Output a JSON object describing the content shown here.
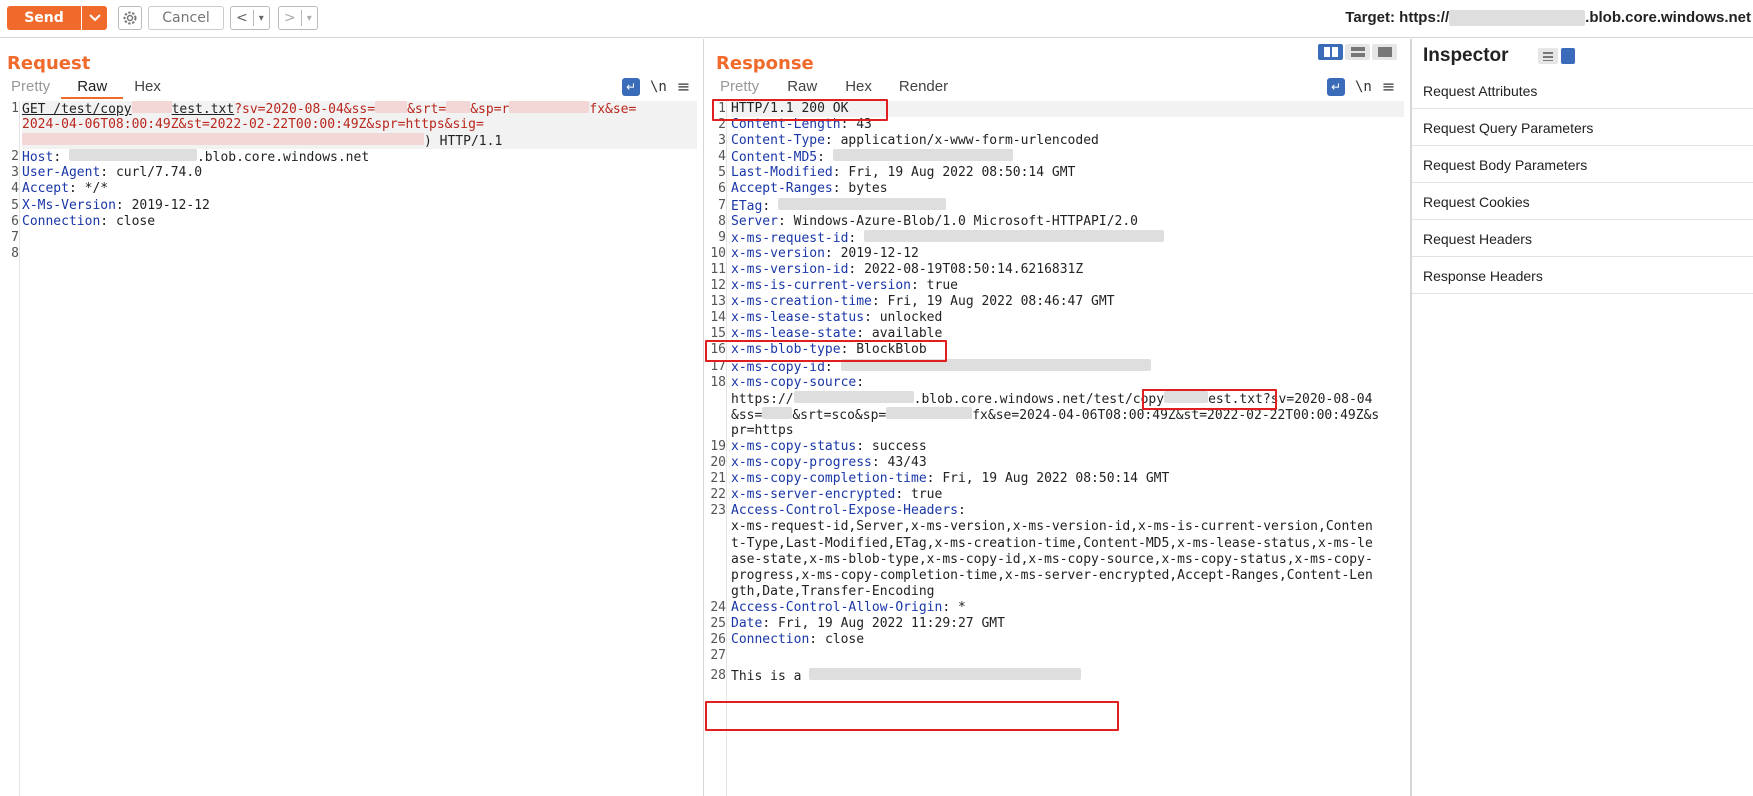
{
  "toolbar": {
    "send_label": "Send",
    "cancel_label": "Cancel",
    "prev_label": "<",
    "next_label": ">",
    "drop_label": "▾",
    "target_prefix": "Target: https://",
    "target_suffix": ".blob.core.windows.net"
  },
  "request": {
    "title": "Request",
    "tabs": [
      "Pretty",
      "Raw",
      "Hex"
    ],
    "active_tab": "Raw",
    "wrap_icon": "↵",
    "newline_label": "\\n",
    "menu_icon": "≡",
    "line_numbers": [
      "1",
      "2",
      "3",
      "4",
      "5",
      "6",
      "7",
      "8"
    ],
    "line1_method": "GET /test/copy",
    "line1_file": "test.txt",
    "line1_q": "?sv=2020-08-04&ss=",
    "line1_srt": "&srt=",
    "line1_sp": "&sp=r",
    "line1_fx": "fx&se=",
    "line1b": "2024-04-06T08:00:49Z&st=2022-02-22T00:00:49Z&spr=https&sig=",
    "line1c": ") HTTP/1.1",
    "headers": [
      {
        "name": "Host",
        "value": ".blob.core.windows.net"
      },
      {
        "name": "User-Agent",
        "value": "curl/7.74.0"
      },
      {
        "name": "Accept",
        "value": "*/*"
      },
      {
        "name": "X-Ms-Version",
        "value": "2019-12-12"
      },
      {
        "name": "Connection",
        "value": "close"
      }
    ]
  },
  "response": {
    "title": "Response",
    "tabs": [
      "Pretty",
      "Raw",
      "Hex",
      "Render"
    ],
    "active_tab": "Raw",
    "status_line": "HTTP/1.1 200 OK",
    "lines": [
      {
        "n": "2",
        "name": "Content-Length",
        "value": "43"
      },
      {
        "n": "3",
        "name": "Content-Type",
        "value": "application/x-www-form-urlencoded"
      },
      {
        "n": "4",
        "name": "Content-MD5",
        "value": ""
      },
      {
        "n": "5",
        "name": "Last-Modified",
        "value": "Fri, 19 Aug 2022 08:50:14 GMT"
      },
      {
        "n": "6",
        "name": "Accept-Ranges",
        "value": "bytes"
      },
      {
        "n": "7",
        "name": "ETag",
        "value": ""
      },
      {
        "n": "8",
        "name": "Server",
        "value": "Windows-Azure-Blob/1.0 Microsoft-HTTPAPI/2.0"
      },
      {
        "n": "9",
        "name": "x-ms-request-id",
        "value": ""
      },
      {
        "n": "10",
        "name": "x-ms-version",
        "value": "2019-12-12"
      },
      {
        "n": "11",
        "name": "x-ms-version-id",
        "value": "2022-08-19T08:50:14.6216831Z"
      },
      {
        "n": "12",
        "name": "x-ms-is-current-version",
        "value": "true"
      },
      {
        "n": "13",
        "name": "x-ms-creation-time",
        "value": "Fri, 19 Aug 2022 08:46:47 GMT"
      },
      {
        "n": "14",
        "name": "x-ms-lease-status",
        "value": "unlocked"
      },
      {
        "n": "15",
        "name": "x-ms-lease-state",
        "value": "available"
      },
      {
        "n": "16",
        "name": "x-ms-blob-type",
        "value": "BlockBlob"
      },
      {
        "n": "17",
        "name": "x-ms-copy-id",
        "value": ""
      },
      {
        "n": "18",
        "name": "x-ms-copy-source",
        "value": ""
      }
    ],
    "copy_source_a": "https://",
    "copy_source_b": ".blob.core.windows.net/test/",
    "copy_source_file_a": "copy",
    "copy_source_file_b": "est.txt",
    "copy_source_c": "?sv=2020-08-04",
    "copy_source_d": "&ss=",
    "copy_source_e": "&srt=sco&sp=",
    "copy_source_f": "fx&se=2024-04-06T08:00:49Z&st=2022-02-22T00:00:49Z&s",
    "copy_source_g": "pr=https",
    "lines2": [
      {
        "n": "19",
        "name": "x-ms-copy-status",
        "value": "success"
      },
      {
        "n": "20",
        "name": "x-ms-copy-progress",
        "value": "43/43"
      },
      {
        "n": "21",
        "name": "x-ms-copy-completion-time",
        "value": "Fri, 19 Aug 2022 08:50:14 GMT"
      },
      {
        "n": "22",
        "name": "x-ms-server-encrypted",
        "value": "true"
      },
      {
        "n": "23",
        "name": "Access-Control-Expose-Headers",
        "value": ""
      }
    ],
    "expose_lines": [
      "x-ms-request-id,Server,x-ms-version,x-ms-version-id,x-ms-is-current-version,Conten",
      "t-Type,Last-Modified,ETag,x-ms-creation-time,Content-MD5,x-ms-lease-status,x-ms-le",
      "ase-state,x-ms-blob-type,x-ms-copy-id,x-ms-copy-source,x-ms-copy-status,x-ms-copy-",
      "progress,x-ms-copy-completion-time,x-ms-server-encrypted,Accept-Ranges,Content-Len",
      "gth,Date,Transfer-Encoding"
    ],
    "lines3": [
      {
        "n": "24",
        "name": "Access-Control-Allow-Origin",
        "value": "*"
      },
      {
        "n": "25",
        "name": "Date",
        "value": "Fri, 19 Aug 2022 11:29:27 GMT"
      },
      {
        "n": "26",
        "name": "Connection",
        "value": "close"
      }
    ],
    "n27": "27",
    "n28": "28",
    "body_text": "This is a "
  },
  "inspector": {
    "title": "Inspector",
    "items": [
      "Request Attributes",
      "Request Query Parameters",
      "Request Body Parameters",
      "Request Cookies",
      "Request Headers",
      "Response Headers"
    ]
  },
  "colors": {
    "accent": "#f06a2c",
    "highlight_box": "#e01f1f",
    "header_key": "#1a37a8",
    "param": "#b9271e"
  }
}
